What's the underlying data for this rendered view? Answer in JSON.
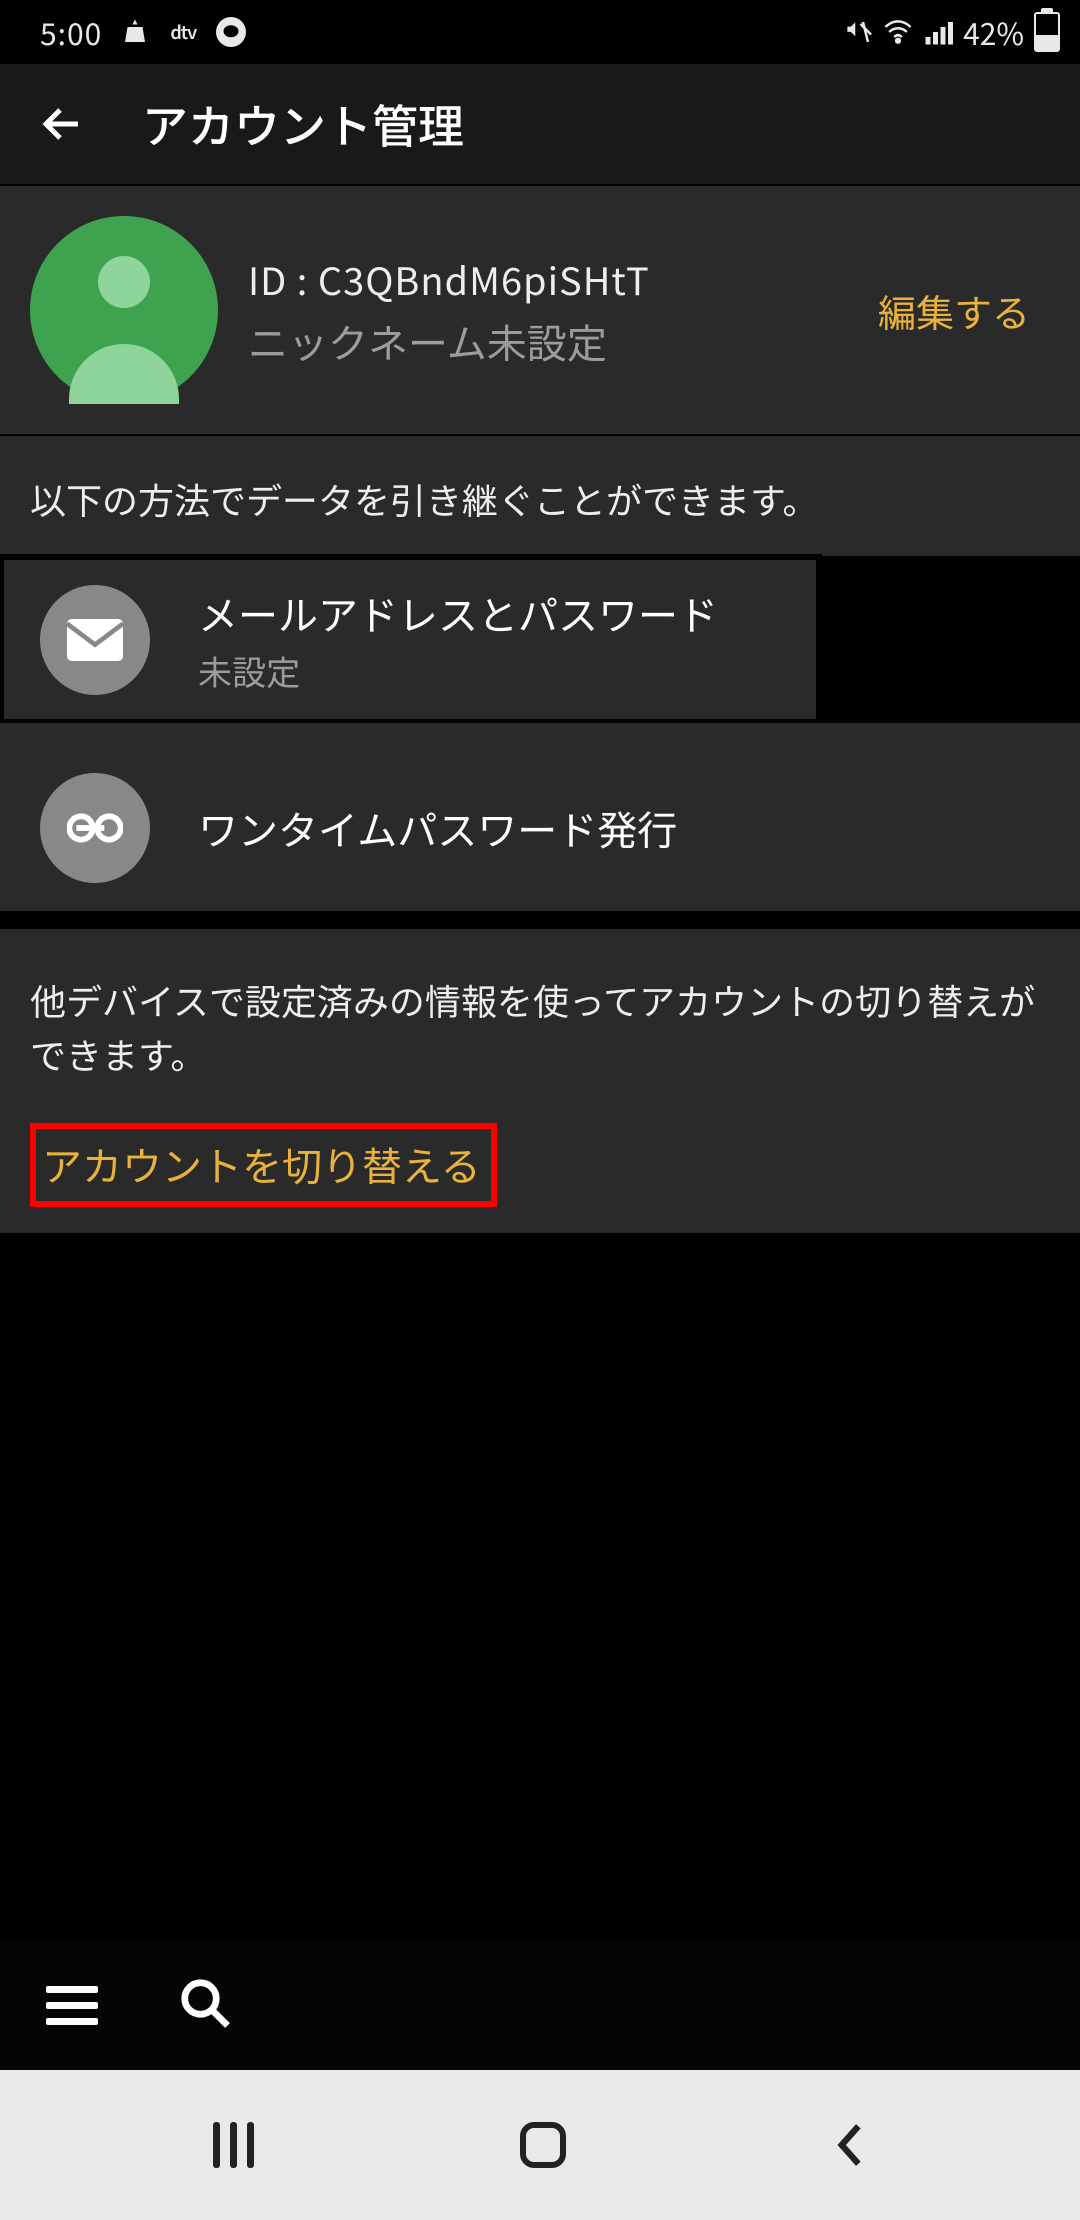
{
  "status": {
    "time": "5:00",
    "battery_pct": "42%"
  },
  "header": {
    "title": "アカウント管理"
  },
  "profile": {
    "id_line": "ID : C3QBndM6piSHtT",
    "nickname": "ニックネーム未設定",
    "edit_label": "編集する"
  },
  "transfer_info": "以下の方法でデータを引き継ぐことができます。",
  "option_mail": {
    "title": "メールアドレスとパスワード",
    "status": "未設定"
  },
  "option_otp": {
    "title": "ワンタイムパスワード発行"
  },
  "switch_info": "他デバイスで設定済みの情報を使ってアカウントの切り替えができます。",
  "switch_link": "アカウントを切り替える"
}
